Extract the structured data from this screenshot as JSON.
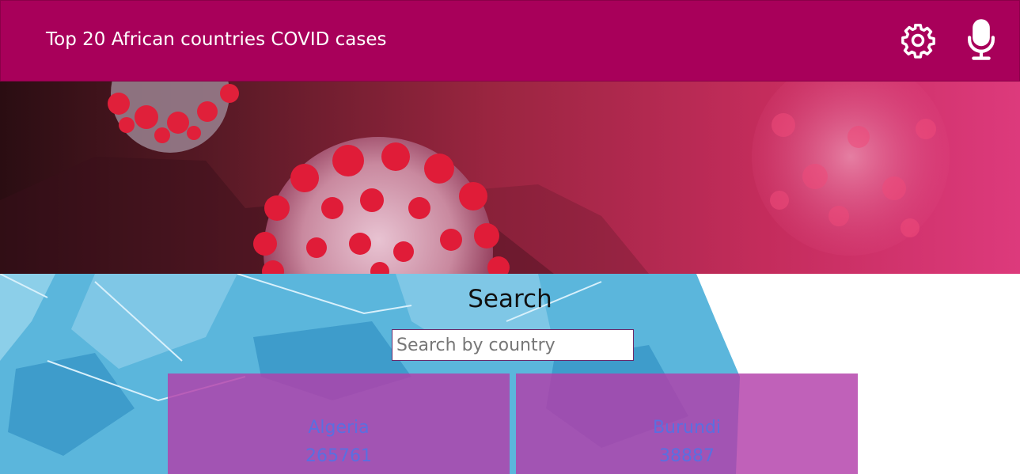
{
  "header": {
    "title": "Top 20 African countries COVID cases",
    "settings_icon": "gear-icon",
    "voice_icon": "microphone-icon",
    "background_color": "#a8005a"
  },
  "search": {
    "heading": "Search",
    "placeholder": "Search by country",
    "value": ""
  },
  "countries": [
    {
      "name": "Algeria",
      "cases": "265761"
    },
    {
      "name": "Burundi",
      "cases": "38887"
    }
  ],
  "colors": {
    "card": "#b23eaa",
    "card_text": "#5a6fe0",
    "hero_accent": "#dd3a7c"
  }
}
